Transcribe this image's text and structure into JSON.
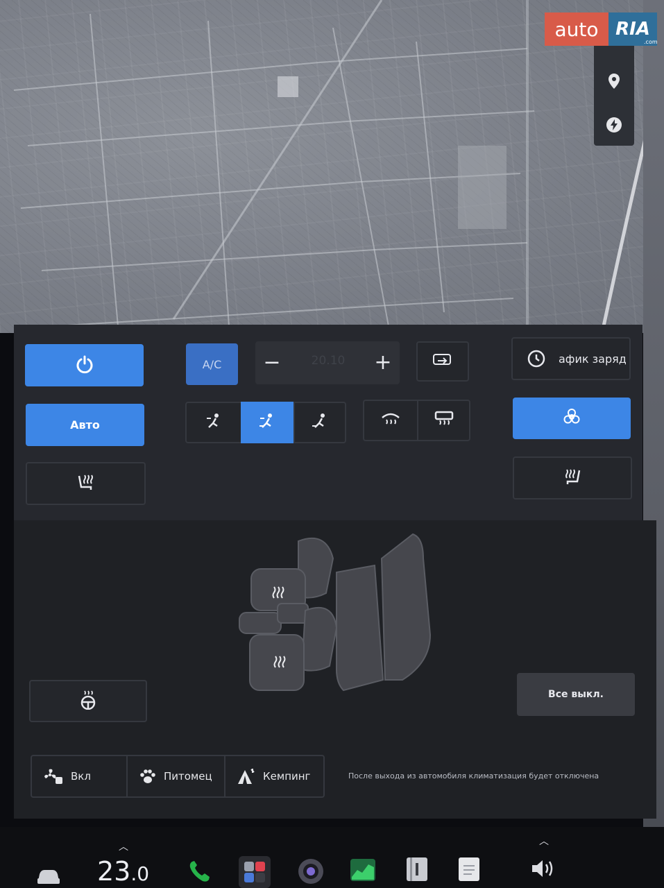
{
  "watermark": {
    "brand_left": "auto",
    "brand_right": "RIA",
    "brand_suffix": ".com"
  },
  "map": {
    "side_buttons": [
      "map-pin-icon",
      "charger-icon"
    ]
  },
  "climate": {
    "ac_label": "A/C",
    "temperature_value": "20.10",
    "auto_label": "Авто",
    "schedule_label": "афик заряд",
    "all_off_label": "Все выкл.",
    "modes": [
      {
        "label": "Вкл",
        "icon": "fan-keep-on-icon"
      },
      {
        "label": "Питомец",
        "icon": "paw-icon"
      },
      {
        "label": "Кемпинг",
        "icon": "camp-tent-icon"
      }
    ],
    "exit_note": "После выхода из автомобиля климатизация будет отключена",
    "colors": {
      "accent": "#3d86e6",
      "ac_active": "#3a6fc4",
      "panel": "#26282e"
    }
  },
  "taskbar": {
    "cabin_temperature_main": "23",
    "cabin_temperature_decimal": ".0",
    "apps": [
      "car-icon",
      "phone-icon",
      "app-launcher-icon",
      "camera-icon",
      "energy-graph-icon",
      "manual-icon",
      "notes-icon",
      "volume-icon"
    ]
  }
}
